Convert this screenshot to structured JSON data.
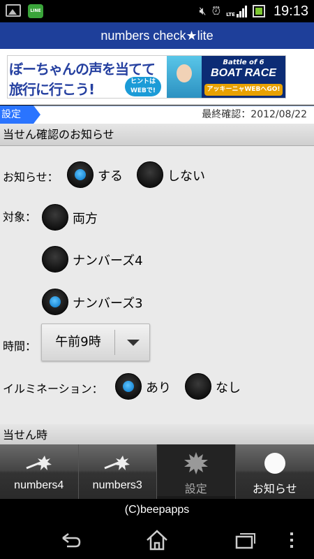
{
  "status_bar": {
    "time": "19:13",
    "left_icons": [
      "image-icon",
      "line-app-icon"
    ],
    "right_icons": [
      "mute-icon",
      "alarm-icon",
      "lte-signal-icon",
      "battery-icon"
    ],
    "line_app_text": "LINE",
    "lte_text": "LTE",
    "battery_level": 0.9
  },
  "app": {
    "title": "numbers check★lite"
  },
  "ad": {
    "line1": "ぼーちゃんの声を当てて",
    "line2": "旅行に行こう!",
    "badge": "ヒントは WEBで!",
    "right_top": "Battle of 6",
    "right_main": "BOAT RACE",
    "right_bottom": "アッキーニャWEBへGO!"
  },
  "header": {
    "tab_label": "設定",
    "last_check": "最終確認：2012/08/22"
  },
  "section1": {
    "title": "当せん確認のお知らせ",
    "notify": {
      "label": "お知らせ：",
      "options": [
        {
          "label": "する",
          "selected": true
        },
        {
          "label": "しない",
          "selected": false
        }
      ]
    },
    "target": {
      "label": "対象：",
      "options": [
        {
          "label": "両方",
          "selected": false
        },
        {
          "label": "ナンバーズ4",
          "selected": false
        },
        {
          "label": "ナンバーズ3",
          "selected": true
        }
      ]
    },
    "time": {
      "label": "時間：",
      "value": "午前9時"
    },
    "illumination": {
      "label": "イルミネーション：",
      "options": [
        {
          "label": "あり",
          "selected": true
        },
        {
          "label": "なし",
          "selected": false
        }
      ]
    }
  },
  "section2": {
    "title": "当せん時"
  },
  "bottom_nav": {
    "items": [
      {
        "label": "numbers4",
        "icon": "lottery-ball-icon",
        "active": false
      },
      {
        "label": "numbers3",
        "icon": "lottery-ball-icon",
        "active": false
      },
      {
        "label": "設定",
        "icon": "settings-burst-icon",
        "active": true
      },
      {
        "label": "お知らせ",
        "icon": "notice-circle-icon",
        "active": false
      }
    ]
  },
  "footer": {
    "copyright": "(C)beepapps"
  },
  "system_nav": {
    "icons": [
      "back-icon",
      "home-icon",
      "recent-apps-icon",
      "menu-icon"
    ]
  },
  "colors": {
    "title_bar": "#1e3f9a",
    "tab_accent": "#2a74ff",
    "radio_selected": "#1d8ad6",
    "content_bg": "#eaeaea"
  }
}
